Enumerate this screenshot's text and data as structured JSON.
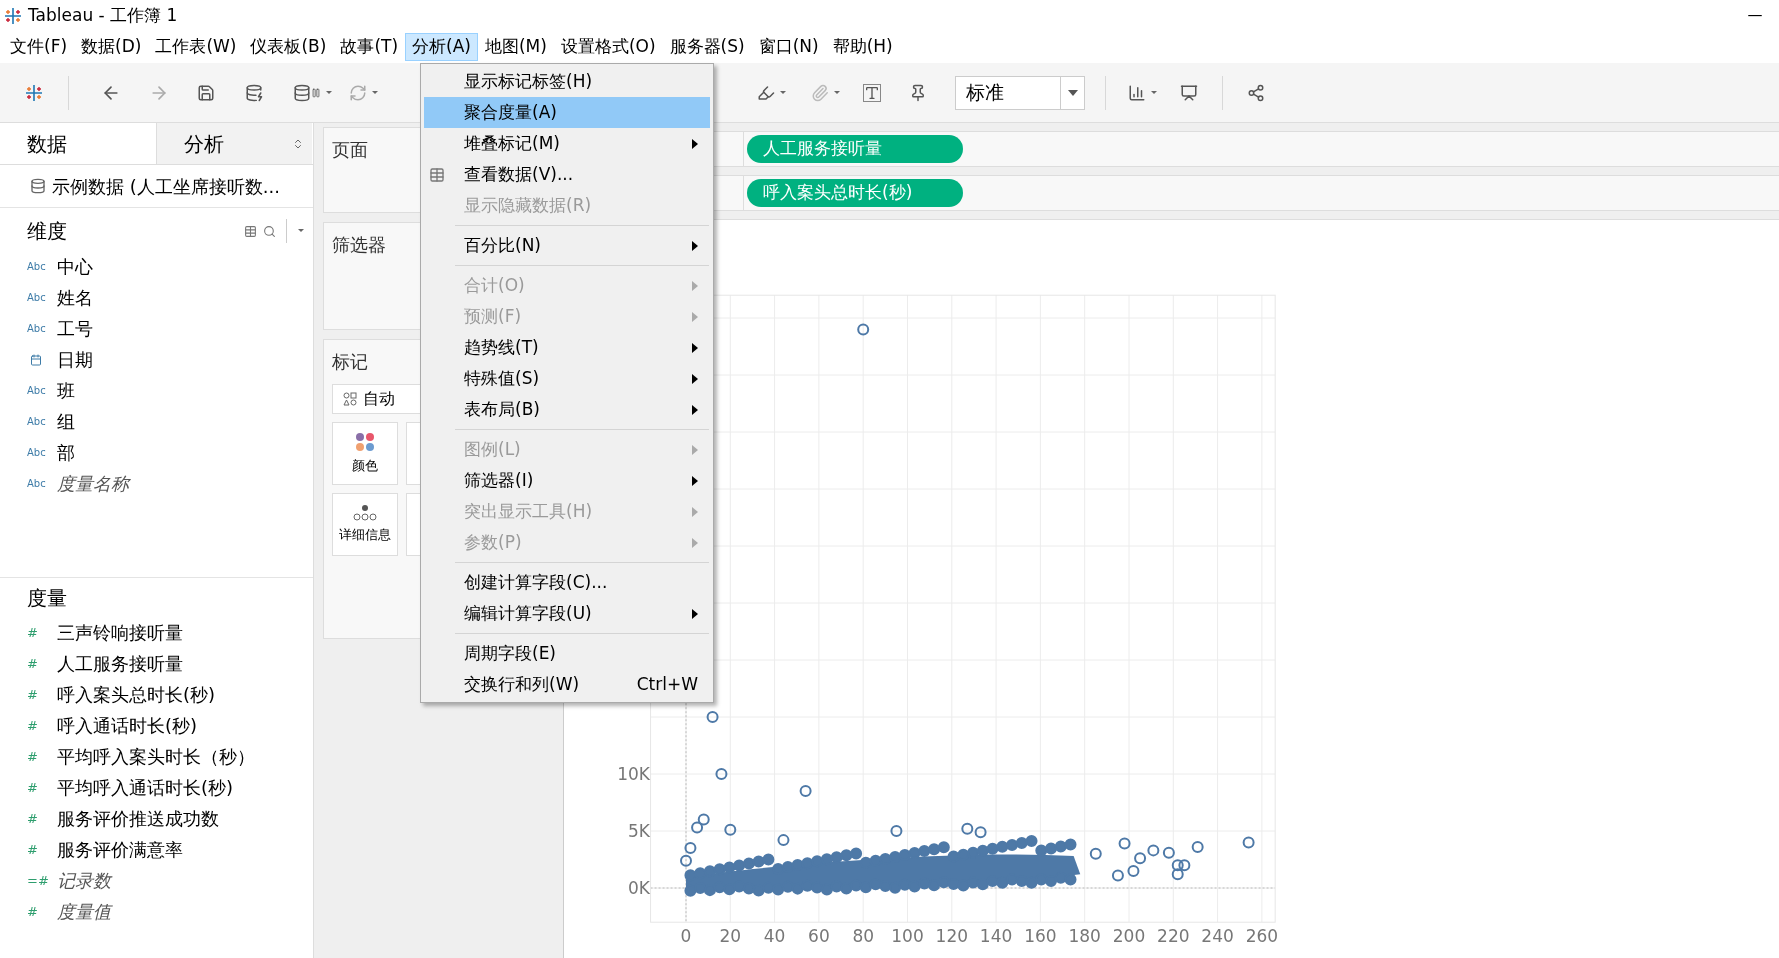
{
  "window": {
    "title": "Tableau - 工作簿 1",
    "minimize": "—"
  },
  "menu_bar": [
    {
      "label": "文件(F)",
      "selected": false
    },
    {
      "label": "数据(D)",
      "selected": false
    },
    {
      "label": "工作表(W)",
      "selected": false
    },
    {
      "label": "仪表板(B)",
      "selected": false
    },
    {
      "label": "故事(T)",
      "selected": false
    },
    {
      "label": "分析(A)",
      "selected": true
    },
    {
      "label": "地图(M)",
      "selected": false
    },
    {
      "label": "设置格式(O)",
      "selected": false
    },
    {
      "label": "服务器(S)",
      "selected": false
    },
    {
      "label": "窗口(N)",
      "selected": false
    },
    {
      "label": "帮助(H)",
      "selected": false
    }
  ],
  "toolbar": {
    "view_size": "标准"
  },
  "data_pane": {
    "tabs": [
      {
        "label": "数据",
        "selected": true
      },
      {
        "label": "分析",
        "selected": false
      }
    ],
    "data_source": "示例数据 (人工坐席接听数...",
    "dimensions": {
      "title": "维度",
      "fields": [
        {
          "kind": "text",
          "type_label": "Abc",
          "label": "中心",
          "generated": false
        },
        {
          "kind": "text",
          "type_label": "Abc",
          "label": "姓名",
          "generated": false
        },
        {
          "kind": "text",
          "type_label": "Abc",
          "label": "工号",
          "generated": false
        },
        {
          "kind": "date",
          "label": "日期",
          "generated": false
        },
        {
          "kind": "text",
          "type_label": "Abc",
          "label": "班",
          "generated": false
        },
        {
          "kind": "text",
          "type_label": "Abc",
          "label": "组",
          "generated": false
        },
        {
          "kind": "text",
          "type_label": "Abc",
          "label": "部",
          "generated": false
        },
        {
          "kind": "text",
          "type_label": "Abc",
          "label": "度量名称",
          "generated": true
        }
      ]
    },
    "measures": {
      "title": "度量",
      "fields": [
        {
          "type_label": "#",
          "label": "三声铃响接听量",
          "generated": false
        },
        {
          "type_label": "#",
          "label": "人工服务接听量",
          "generated": false
        },
        {
          "type_label": "#",
          "label": "呼入案头总时长(秒)",
          "generated": false
        },
        {
          "type_label": "#",
          "label": "呼入通话时长(秒)",
          "generated": false
        },
        {
          "type_label": "#",
          "label": "平均呼入案头时长（秒）",
          "generated": false
        },
        {
          "type_label": "#",
          "label": "平均呼入通话时长(秒)",
          "generated": false
        },
        {
          "type_label": "#",
          "label": "服务评价推送成功数",
          "generated": false
        },
        {
          "type_label": "#",
          "label": "服务评价满意率",
          "generated": false
        },
        {
          "type_label": "=#",
          "label": "记录数",
          "generated": true
        },
        {
          "type_label": "#",
          "label": "度量值",
          "generated": true
        }
      ]
    }
  },
  "cards": {
    "pages": "页面",
    "filters": "筛选器",
    "marks": {
      "title": "标记",
      "mark_type": "自动",
      "buttons": [
        {
          "kind": "color",
          "label": "颜色"
        },
        {
          "kind": "detail",
          "label": "详细信息"
        }
      ]
    }
  },
  "columns_shelf": {
    "pills": [
      "人工服务接听量"
    ]
  },
  "rows_shelf": {
    "pills": [
      "呼入案头总时长(秒)"
    ]
  },
  "context_menu": {
    "items": [
      {
        "kind": "item",
        "label": "显示标记标签(H)",
        "disabled": false,
        "submenu": false,
        "selected": false
      },
      {
        "kind": "item",
        "label": "聚合度量(A)",
        "disabled": false,
        "submenu": false,
        "selected": true
      },
      {
        "kind": "item",
        "label": "堆叠标记(M)",
        "disabled": false,
        "submenu": true,
        "selected": false
      },
      {
        "kind": "table_item",
        "label": "查看数据(V)...",
        "disabled": false,
        "submenu": false,
        "selected": false
      },
      {
        "kind": "item",
        "label": "显示隐藏数据(R)",
        "disabled": true,
        "submenu": false,
        "selected": false
      },
      {
        "kind": "separator"
      },
      {
        "kind": "item",
        "label": "百分比(N)",
        "disabled": false,
        "submenu": true,
        "selected": false
      },
      {
        "kind": "separator"
      },
      {
        "kind": "item",
        "label": "合计(O)",
        "disabled": true,
        "submenu": true,
        "selected": false
      },
      {
        "kind": "item",
        "label": "预测(F)",
        "disabled": true,
        "submenu": true,
        "selected": false
      },
      {
        "kind": "item",
        "label": "趋势线(T)",
        "disabled": false,
        "submenu": true,
        "selected": false
      },
      {
        "kind": "item",
        "label": "特殊值(S)",
        "disabled": false,
        "submenu": true,
        "selected": false
      },
      {
        "kind": "item",
        "label": "表布局(B)",
        "disabled": false,
        "submenu": true,
        "selected": false
      },
      {
        "kind": "separator"
      },
      {
        "kind": "item",
        "label": "图例(L)",
        "disabled": true,
        "submenu": true,
        "selected": false
      },
      {
        "kind": "item",
        "label": "筛选器(I)",
        "disabled": false,
        "submenu": true,
        "selected": false
      },
      {
        "kind": "item",
        "label": "突出显示工具(H)",
        "disabled": true,
        "submenu": true,
        "selected": false
      },
      {
        "kind": "item",
        "label": "参数(P)",
        "disabled": true,
        "submenu": true,
        "selected": false
      },
      {
        "kind": "separator"
      },
      {
        "kind": "item",
        "label": "创建计算字段(C)...",
        "disabled": false,
        "submenu": false,
        "selected": false
      },
      {
        "kind": "item",
        "label": "编辑计算字段(U)",
        "disabled": false,
        "submenu": true,
        "selected": false
      },
      {
        "kind": "separator"
      },
      {
        "kind": "item",
        "label": "周期字段(E)",
        "disabled": false,
        "submenu": false,
        "selected": false
      },
      {
        "kind": "item",
        "label": "交换行和列(W)",
        "disabled": false,
        "submenu": false,
        "selected": false,
        "shortcut": "Ctrl+W"
      }
    ]
  },
  "chart": {
    "chart_data": {
      "type": "scatter",
      "grid": true,
      "xlim": [
        -16,
        266
      ],
      "ylim": [
        -3000,
        52000
      ],
      "xticks": [
        0,
        20,
        40,
        60,
        80,
        100,
        120,
        140,
        160,
        180,
        200,
        220,
        240,
        260
      ],
      "yticks": [
        {
          "value": 0,
          "label": "0K"
        },
        {
          "value": 5000,
          "label": "5K"
        },
        {
          "value": 10000,
          "label": "10K"
        }
      ],
      "x": [
        80,
        12,
        16,
        54,
        8,
        5,
        20,
        95,
        127,
        133,
        44,
        2,
        0,
        254,
        231,
        198,
        218,
        211,
        205,
        222,
        225,
        222,
        202,
        195,
        185
      ],
      "series": [
        {
          "color": "#4e79a7",
          "values": [
            49000,
            15000,
            10000,
            8500,
            6000,
            5300,
            5100,
            5000,
            5200,
            4900,
            4200,
            3500,
            2400,
            4000,
            3600,
            3900,
            3100,
            3300,
            2600,
            2000,
            2000,
            1200,
            1500,
            1100,
            3000
          ]
        }
      ]
    }
  }
}
